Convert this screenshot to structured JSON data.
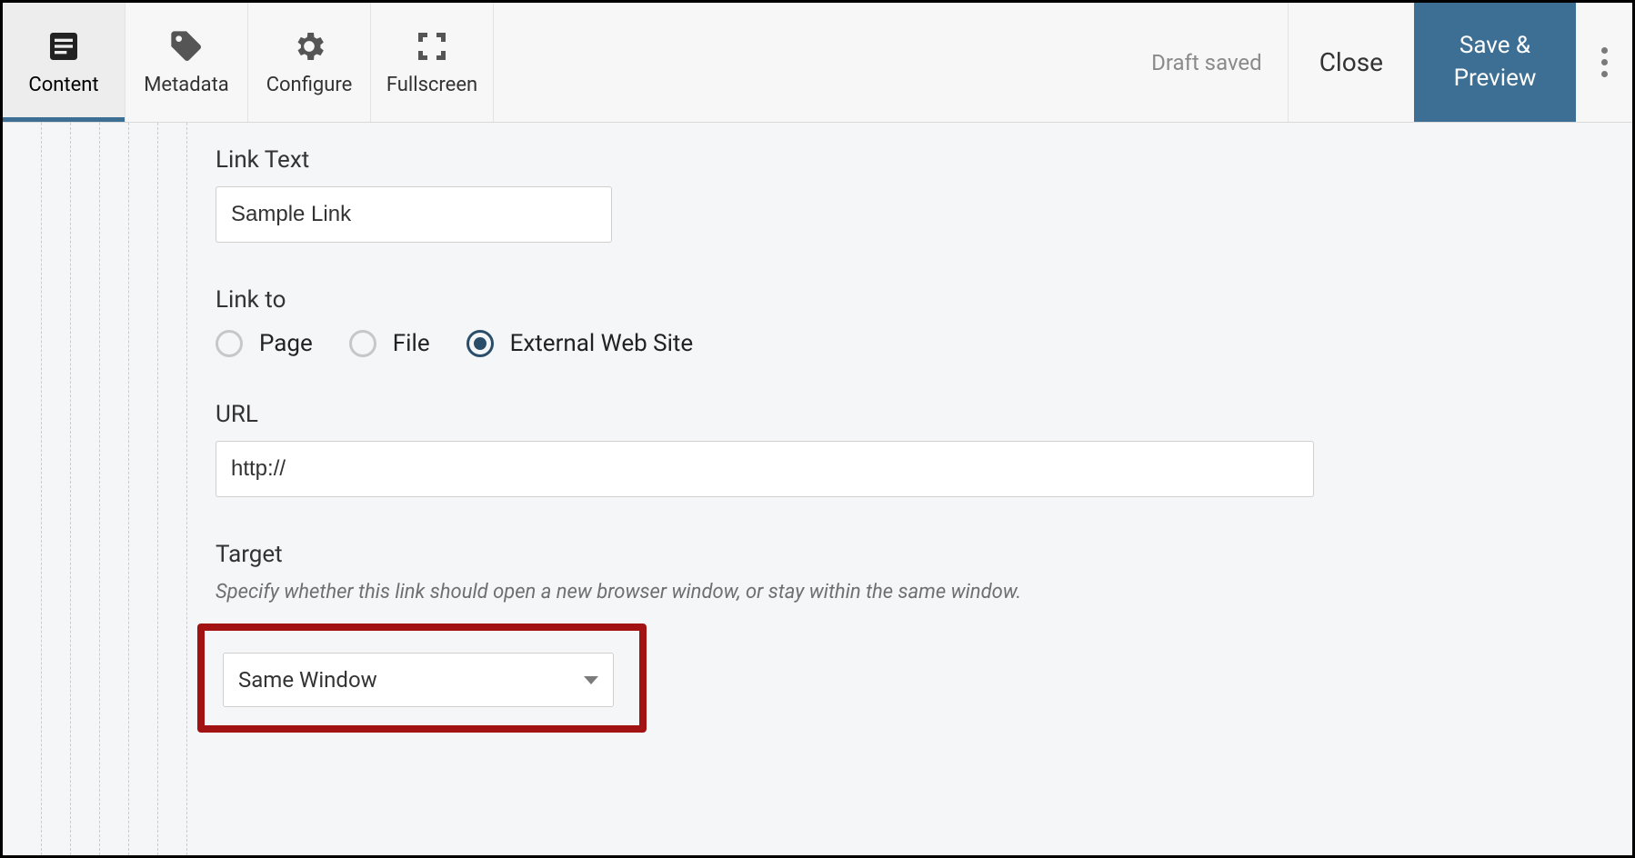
{
  "toolbar": {
    "tabs": {
      "content": "Content",
      "metadata": "Metadata",
      "configure": "Configure",
      "fullscreen": "Fullscreen"
    },
    "status": "Draft saved",
    "close": "Close",
    "save_line1": "Save &",
    "save_line2": "Preview"
  },
  "form": {
    "link_text": {
      "label": "Link Text",
      "value": "Sample Link"
    },
    "link_to": {
      "label": "Link to",
      "options": {
        "page": "Page",
        "file": "File",
        "external": "External Web Site"
      },
      "selected": "external"
    },
    "url": {
      "label": "URL",
      "value": "http://"
    },
    "target": {
      "label": "Target",
      "help": "Specify whether this link should open a new browser window, or stay within the same window.",
      "value": "Same Window"
    }
  }
}
